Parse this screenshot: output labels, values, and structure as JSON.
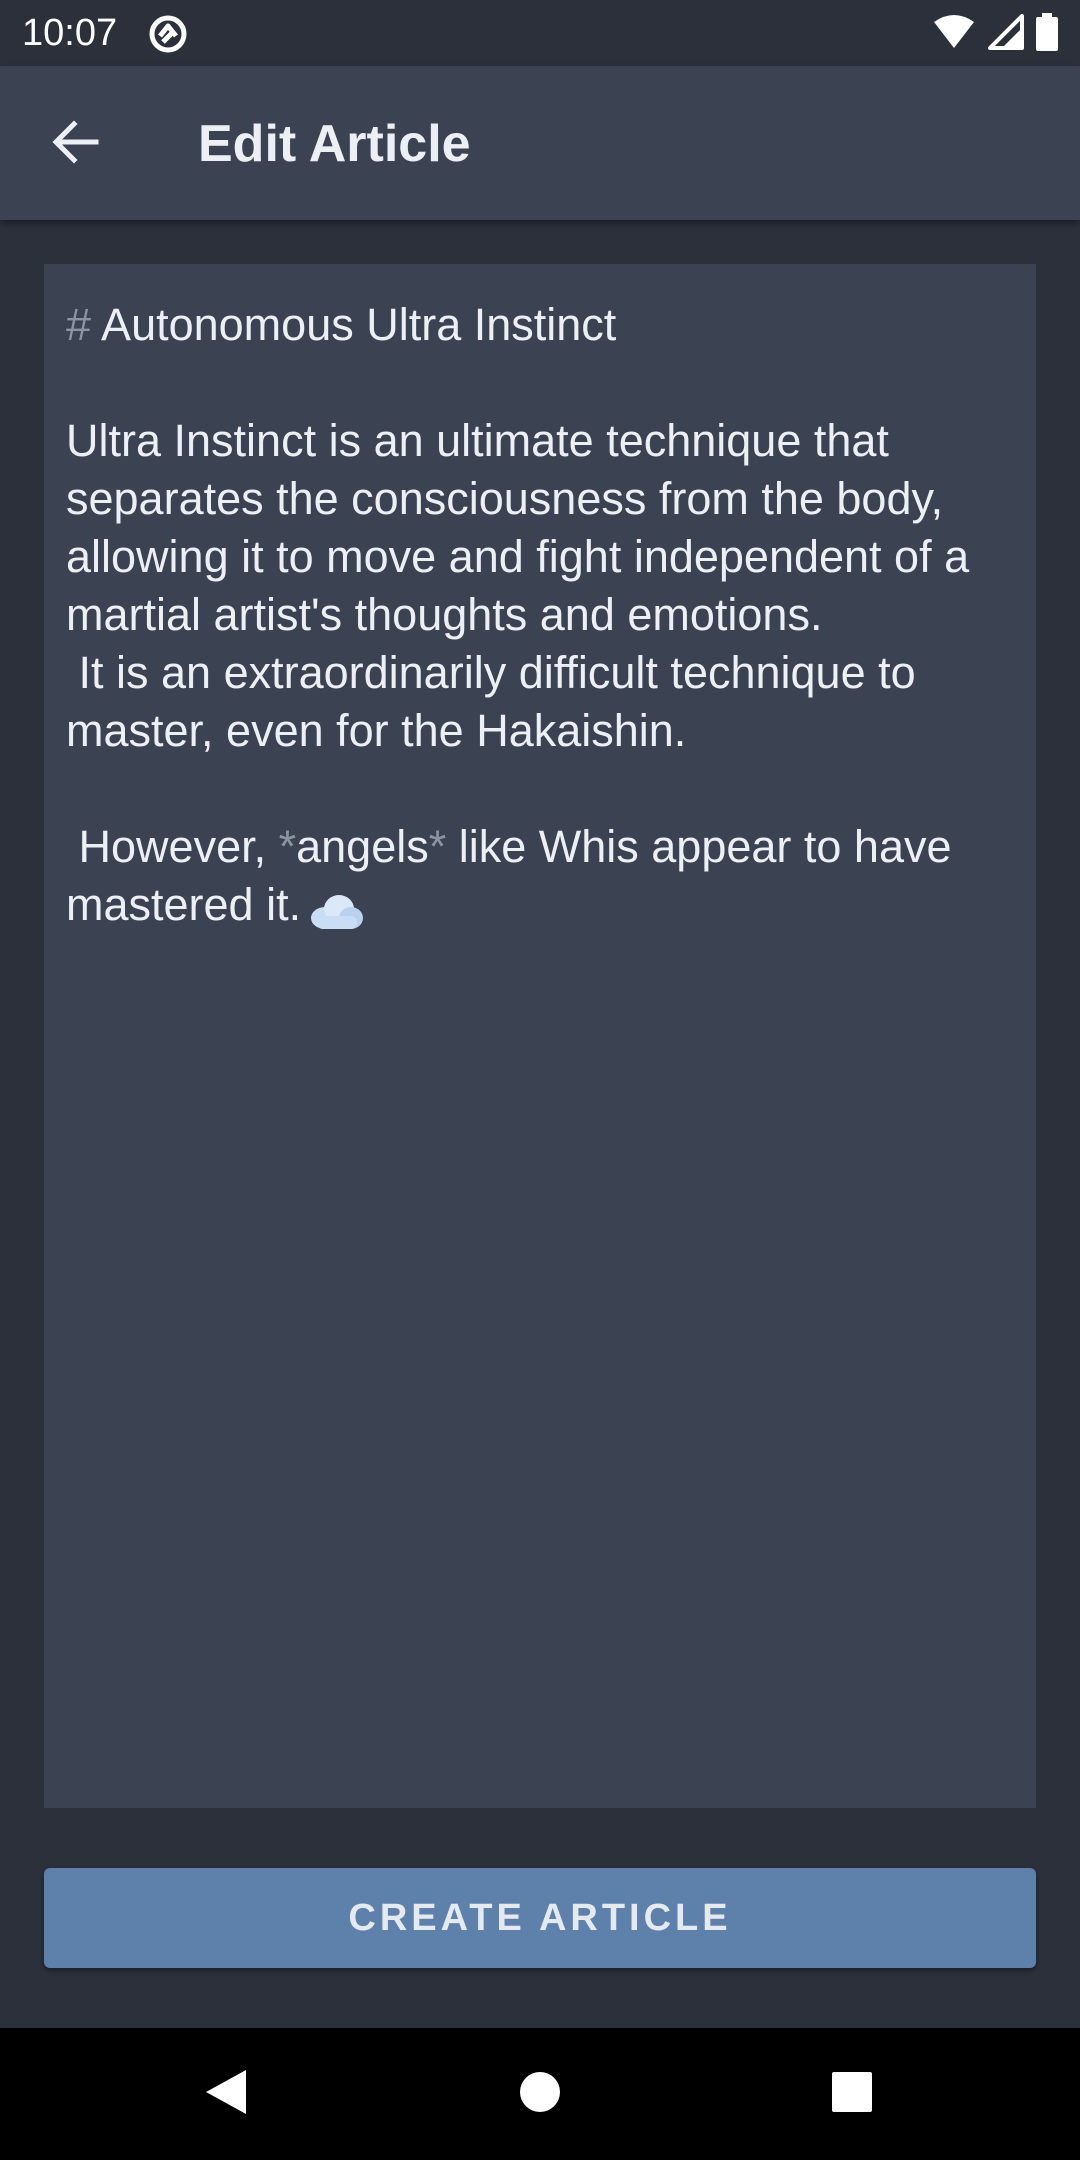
{
  "status_bar": {
    "time": "10:07",
    "icons": [
      "sync-badge-icon",
      "wifi-icon",
      "cellular-signal-icon",
      "battery-icon"
    ]
  },
  "app_bar": {
    "title": "Edit Article",
    "back_icon": "arrow-back-icon"
  },
  "editor": {
    "heading_mark": "#",
    "heading_text": " Autonomous Ultra Instinct",
    "paragraph_1": "Ultra Instinct is an ultimate technique that separates the consciousness from the body, allowing it to move and fight independent of a martial artist's thoughts and emotions.",
    "paragraph_2": " It is an extraordinarily difficult technique to master, even for the Hakaishin.",
    "paragraph_3_before": " However, ",
    "emphasis_open": "*",
    "emphasis_word": "angels",
    "emphasis_close": "*",
    "paragraph_3_after": " like Whis appear to have mastered it.",
    "emoji_icon": "cloud-icon"
  },
  "actions": {
    "create_label": "CREATE ARTICLE"
  },
  "colors": {
    "background": "#2b303b",
    "surface": "#3b4252",
    "text": "#eceff4",
    "markdown_mark": "#8c94a4",
    "button": "#5e81ac"
  },
  "nav_bar": {
    "icons": [
      "nav-back-icon",
      "nav-home-icon",
      "nav-recents-icon"
    ]
  }
}
